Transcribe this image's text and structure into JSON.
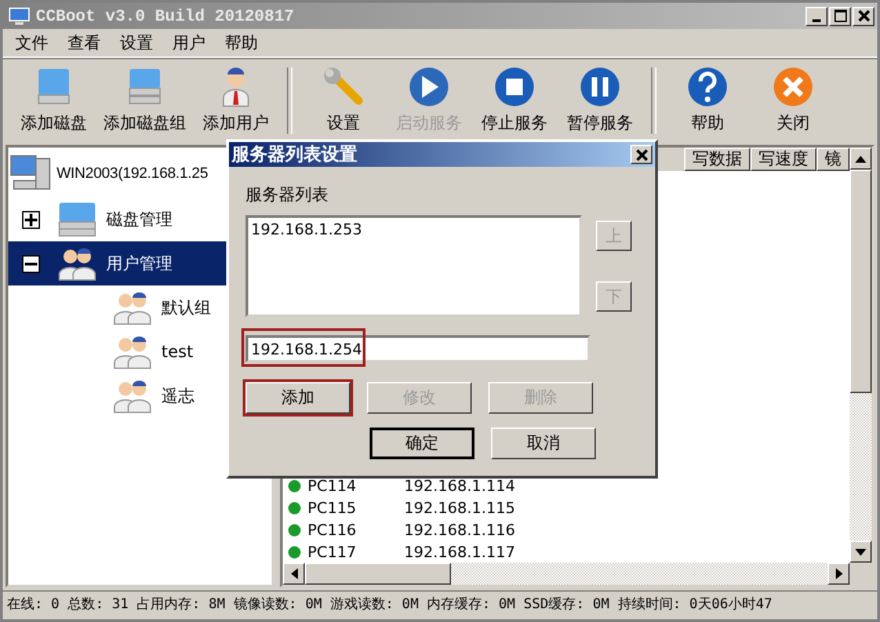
{
  "window": {
    "title": "CCBoot v3.0 Build 20120817"
  },
  "menu": [
    "文件",
    "查看",
    "设置",
    "用户",
    "帮助"
  ],
  "toolbar": {
    "groups": [
      [
        {
          "label": "添加磁盘",
          "kind": "disk",
          "disabled": false
        },
        {
          "label": "添加磁盘组",
          "kind": "disk-group",
          "disabled": false
        },
        {
          "label": "添加用户",
          "kind": "user",
          "disabled": false
        }
      ],
      [
        {
          "label": "设置",
          "kind": "wrench",
          "disabled": false
        },
        {
          "label": "启动服务",
          "kind": "play",
          "disabled": true
        },
        {
          "label": "停止服务",
          "kind": "stop",
          "disabled": false
        },
        {
          "label": "暂停服务",
          "kind": "pause",
          "disabled": false
        }
      ],
      [
        {
          "label": "帮助",
          "kind": "help",
          "disabled": false
        },
        {
          "label": "关闭",
          "kind": "close",
          "disabled": false
        }
      ]
    ]
  },
  "tree": {
    "label": "WIN2003(192.168.1.25",
    "kind": "computer",
    "children": [
      {
        "label": "磁盘管理",
        "kind": "disk",
        "expanded": false,
        "selected": false
      },
      {
        "label": "用户管理",
        "kind": "users",
        "expanded": true,
        "selected": true,
        "children": [
          {
            "label": "默认组",
            "kind": "users",
            "selected": false
          },
          {
            "label": "test",
            "kind": "users",
            "selected": false
          },
          {
            "label": "遥志",
            "kind": "users",
            "selected": false
          }
        ]
      }
    ]
  },
  "list": {
    "columns": [
      "写数据",
      "写速度",
      "镜"
    ],
    "rows": [
      {
        "name": "PC114",
        "ip": "192.168.1.114",
        "online": true
      },
      {
        "name": "PC115",
        "ip": "192.168.1.115",
        "online": true
      },
      {
        "name": "PC116",
        "ip": "192.168.1.116",
        "online": true
      },
      {
        "name": "PC117",
        "ip": "192.168.1.117",
        "online": true
      }
    ]
  },
  "dialog": {
    "title": "服务器列表设置",
    "list_label": "服务器列表",
    "servers": [
      "192.168.1.253"
    ],
    "up_button": {
      "label": "上",
      "disabled": true
    },
    "down_button": {
      "label": "下",
      "disabled": true
    },
    "input": {
      "value": "192.168.1.254",
      "highlighted": true
    },
    "buttons": [
      {
        "label": "添加",
        "disabled": false,
        "highlighted": true,
        "default": false
      },
      {
        "label": "修改",
        "disabled": true,
        "highlighted": false,
        "default": false
      },
      {
        "label": "删除",
        "disabled": true,
        "highlighted": false,
        "default": false
      }
    ],
    "footer_buttons": [
      {
        "label": "确定",
        "disabled": false,
        "highlighted": false,
        "default": true
      },
      {
        "label": "取消",
        "disabled": false,
        "highlighted": false,
        "default": false
      }
    ]
  },
  "status_bar": "在线: 0 总数: 31 占用内存: 8M 镜像读数: 0M 游戏读数: 0M 内存缓存: 0M SSD缓存: 0M 持续时间: 0天06小时47"
}
